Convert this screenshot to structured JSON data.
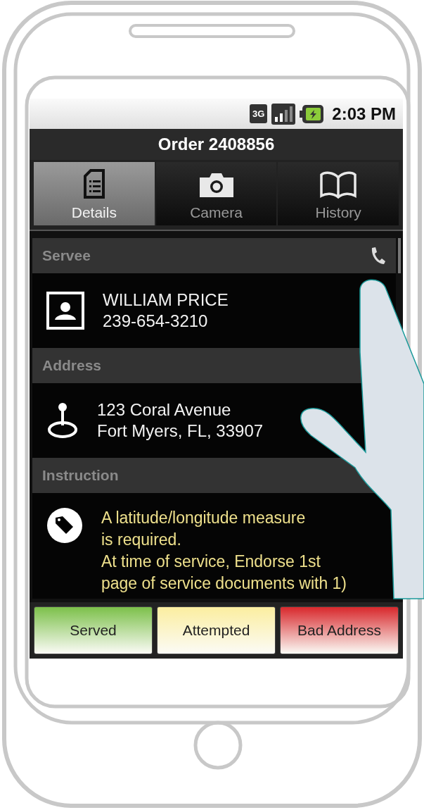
{
  "status_bar": {
    "network": "3G",
    "time": "2:03 PM"
  },
  "title": "Order 2408856",
  "tabs": [
    {
      "label": "Details",
      "selected": true
    },
    {
      "label": "Camera",
      "selected": false
    },
    {
      "label": "History",
      "selected": false
    }
  ],
  "sections": [
    {
      "header": "Servee",
      "kind": "contact",
      "text": "WILLIAM PRICE\n239-654-3210"
    },
    {
      "header": "Address",
      "kind": "address",
      "text": "123 Coral Avenue\nFort Myers, FL, 33907"
    },
    {
      "header": "Instruction",
      "kind": "note",
      "text": "A latitude/longitude measure\nis required.\nAt time of service, Endorse 1st\npage of service documents with 1)"
    }
  ],
  "actions": [
    {
      "label": "Served",
      "color": "#7cc04a"
    },
    {
      "label": "Attempted",
      "color": "#fbeea0"
    },
    {
      "label": "Bad Address",
      "color": "#d8282c"
    }
  ]
}
